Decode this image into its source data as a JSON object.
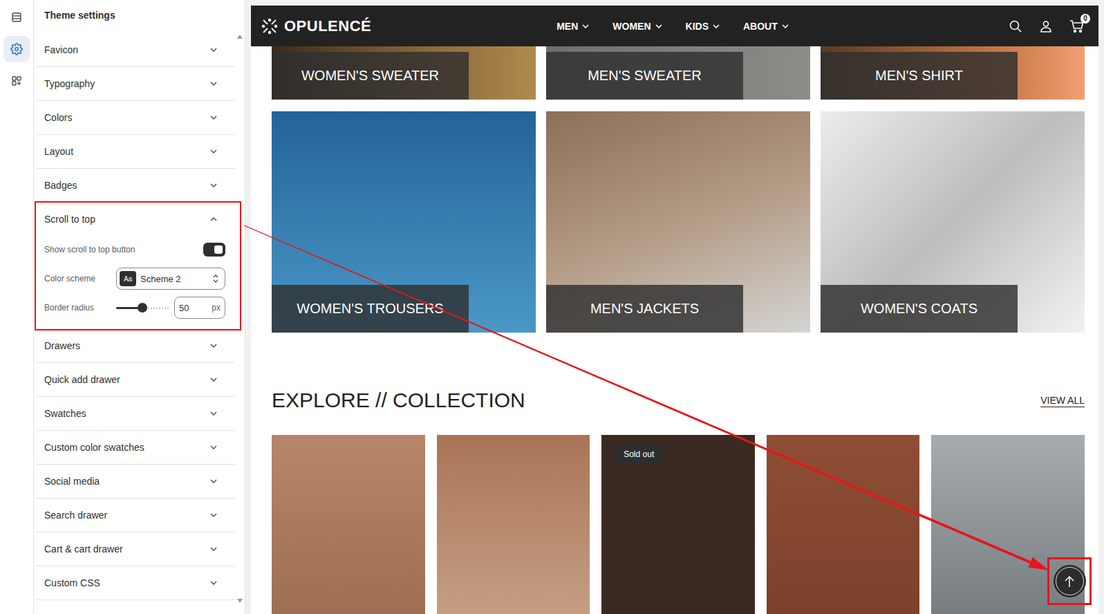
{
  "rail": [
    {
      "kind": "sections",
      "selected": false
    },
    {
      "kind": "settings",
      "selected": true
    },
    {
      "kind": "apps",
      "selected": false
    }
  ],
  "panel": {
    "title": "Theme settings",
    "sections": [
      {
        "label": "Favicon",
        "expanded": false,
        "highlighted": false
      },
      {
        "label": "Typography",
        "expanded": false,
        "highlighted": false
      },
      {
        "label": "Colors",
        "expanded": false,
        "highlighted": false
      },
      {
        "label": "Layout",
        "expanded": false,
        "highlighted": false
      },
      {
        "label": "Badges",
        "expanded": false,
        "highlighted": false
      },
      {
        "label": "Scroll to top",
        "expanded": true,
        "highlighted": true,
        "settings": {
          "show_label": "Show scroll to top button",
          "show_on": true,
          "scheme_label": "Color scheme",
          "scheme_badge": "Aa",
          "scheme_value": "Scheme 2",
          "radius_label": "Border radius",
          "radius_level": 0.5,
          "radius_value": "50",
          "radius_unit": "px"
        }
      },
      {
        "label": "Drawers",
        "expanded": false,
        "highlighted": false
      },
      {
        "label": "Quick add drawer",
        "expanded": false,
        "highlighted": false
      },
      {
        "label": "Swatches",
        "expanded": false,
        "highlighted": false
      },
      {
        "label": "Custom color swatches",
        "expanded": false,
        "highlighted": false
      },
      {
        "label": "Social media",
        "expanded": false,
        "highlighted": false
      },
      {
        "label": "Search drawer",
        "expanded": false,
        "highlighted": false
      },
      {
        "label": "Cart & cart drawer",
        "expanded": false,
        "highlighted": false
      },
      {
        "label": "Custom CSS",
        "expanded": false,
        "highlighted": false
      }
    ]
  },
  "storefront": {
    "logo": "OPULENCÉ",
    "nav": [
      {
        "label": "MEN"
      },
      {
        "label": "WOMEN"
      },
      {
        "label": "KIDS"
      },
      {
        "label": "ABOUT"
      }
    ],
    "cart_count": "0",
    "category_rows": [
      {
        "cut_off": true,
        "items": [
          {
            "label": "WOMEN'S SWEATER"
          },
          {
            "label": "MEN'S SWEATER"
          },
          {
            "label": "MEN'S SHIRT"
          }
        ]
      },
      {
        "cut_off": false,
        "items": [
          {
            "label": "WOMEN'S TROUSERS"
          },
          {
            "label": "MEN'S JACKETS"
          },
          {
            "label": "WOMEN'S COATS"
          }
        ]
      }
    ],
    "collection_title": "EXPLORE // COLLECTION",
    "view_all": "VIEW ALL",
    "sold_out_label": "Sold out",
    "products": [
      {
        "sold_out": false
      },
      {
        "sold_out": false
      },
      {
        "sold_out": true
      },
      {
        "sold_out": false
      },
      {
        "sold_out": false
      }
    ],
    "scroll_button": {
      "visible": true,
      "highlighted": true
    }
  },
  "annotation": {
    "visible": true
  }
}
